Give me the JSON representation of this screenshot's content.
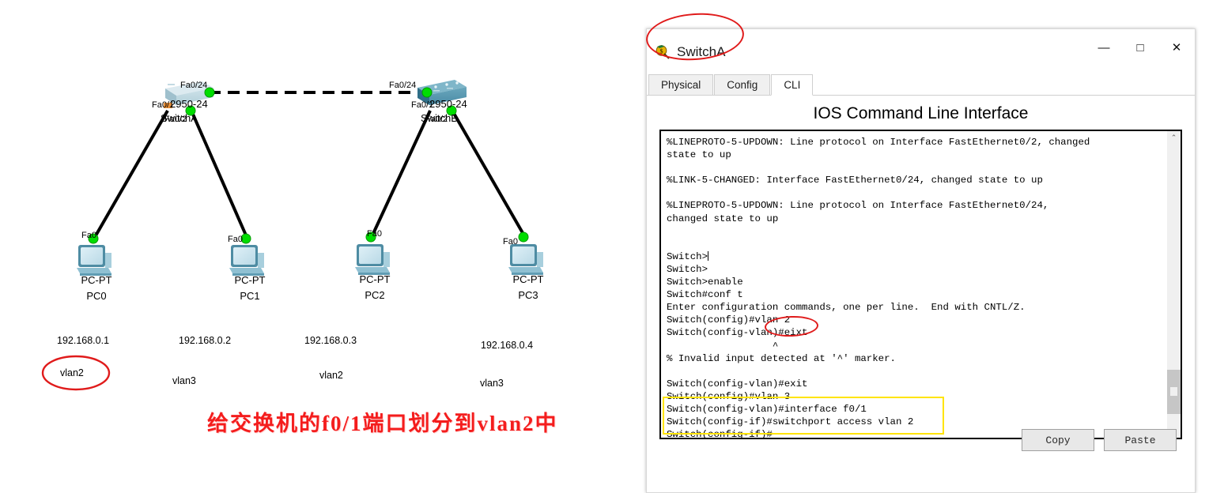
{
  "topology": {
    "switches": [
      {
        "id": "switchA",
        "uplink_port": "Fa0/24",
        "model": "2950-24",
        "name": "SwitchA",
        "port1": "Fa0/1",
        "port2": "Fa0/2"
      },
      {
        "id": "switchB",
        "uplink_port": "Fa0/24",
        "model": "2950-24",
        "name": "SwitchB",
        "port1": "Fa0/1",
        "port2": "Fa0/2"
      }
    ],
    "pcs": [
      {
        "port": "Fa0",
        "type": "PC-PT",
        "name": "PC0",
        "ip": "192.168.0.1",
        "vlan": "vlan2"
      },
      {
        "port": "Fa0",
        "type": "PC-PT",
        "name": "PC1",
        "ip": "192.168.0.2",
        "vlan": "vlan3"
      },
      {
        "port": "Fa0",
        "type": "PC-PT",
        "name": "PC2",
        "ip": "192.168.0.3",
        "vlan": "vlan2"
      },
      {
        "port": "Fa0",
        "type": "PC-PT",
        "name": "PC3",
        "ip": "192.168.0.4",
        "vlan": "vlan3"
      }
    ],
    "caption": "给交换机的f0/1端口划分到vlan2中",
    "colors": {
      "switch_selected": "#b9d4dd",
      "switch_normal": "#4a8ba6",
      "pc_body": "#7fb3c4",
      "link_green": "#00cc00",
      "annotation_red": "#e01b1b",
      "annotation_yellow": "#ffe400",
      "caption_red": "#f41d1d"
    }
  },
  "window": {
    "title": "SwitchA",
    "icon": "switch-device-icon",
    "controls": {
      "minimize": "—",
      "maximize": "□",
      "close": "✕"
    },
    "tabs": [
      {
        "label": "Physical",
        "active": false
      },
      {
        "label": "Config",
        "active": false
      },
      {
        "label": "CLI",
        "active": true
      }
    ],
    "cli_heading": "IOS Command Line Interface",
    "cli_text": "%LINEPROTO-5-UPDOWN: Line protocol on Interface FastEthernet0/2, changed\nstate to up\n\n%LINK-5-CHANGED: Interface FastEthernet0/24, changed state to up\n\n%LINEPROTO-5-UPDOWN: Line protocol on Interface FastEthernet0/24,\nchanged state to up\n\n\nSwitch>\nSwitch>\nSwitch>enable\nSwitch#conf t\nEnter configuration commands, one per line.  End with CNTL/Z.\nSwitch(config)#vlan 2\nSwitch(config-vlan)#eixt\n                  ^\n% Invalid input detected at '^' marker.\n\nSwitch(config-vlan)#exit\nSwitch(config)#vlan 3\nSwitch(config-vlan)#interface f0/1\nSwitch(config-if)#switchport access vlan 2\nSwitch(config-if)#",
    "buttons": {
      "copy": "Copy",
      "paste": "Paste"
    },
    "scrollbar": {
      "up_arrow": "⌃",
      "down_arrow": "⌄"
    }
  }
}
